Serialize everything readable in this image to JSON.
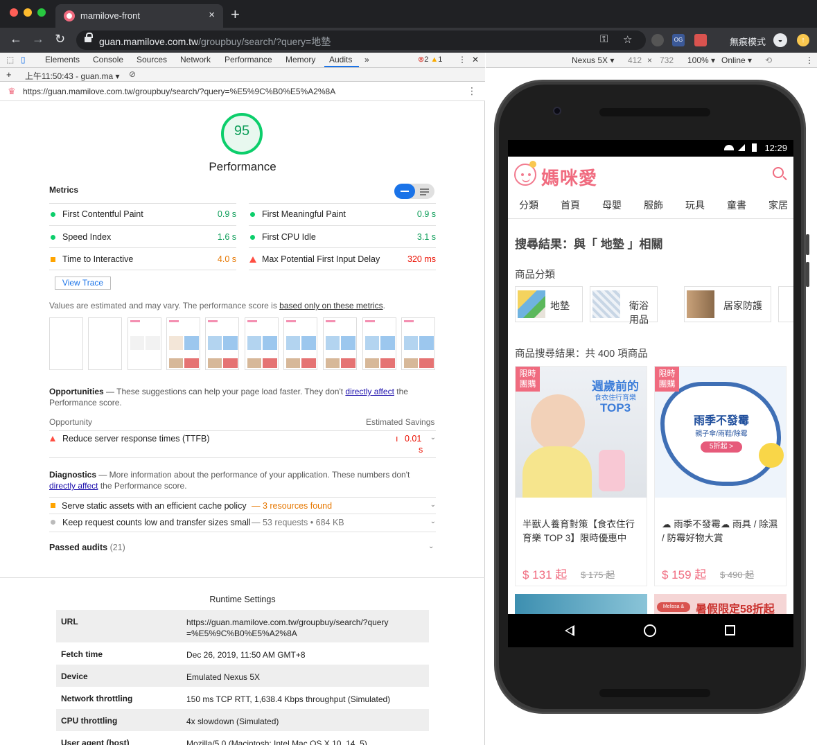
{
  "browser": {
    "tab_title": "mamilove-front",
    "tab_close": "×",
    "new_tab": "+",
    "url_host": "guan.mamilove.com.tw",
    "url_path": "/groupbuy/search/?query=地墊",
    "incognito_label": "無痕模式",
    "ext_og": "OG"
  },
  "devtools": {
    "tabs": [
      "Elements",
      "Console",
      "Sources",
      "Network",
      "Performance",
      "Memory",
      "Audits"
    ],
    "active_tab": "Audits",
    "more_tabs": "»",
    "errors": "2",
    "warnings": "1",
    "session_label": "上午11:50:43 - guan.ma",
    "audited_url": "https://guan.mamilove.com.tw/groupbuy/search/?query=%E5%9C%B0%E5%A2%8A"
  },
  "lighthouse": {
    "score": "95",
    "score_value": 95,
    "category": "Performance",
    "metrics_heading": "Metrics",
    "metrics": [
      {
        "name": "First Contentful Paint",
        "value": "0.9 s",
        "status": "pass"
      },
      {
        "name": "First Meaningful Paint",
        "value": "0.9 s",
        "status": "pass"
      },
      {
        "name": "Speed Index",
        "value": "1.6 s",
        "status": "pass"
      },
      {
        "name": "First CPU Idle",
        "value": "3.1 s",
        "status": "pass"
      },
      {
        "name": "Time to Interactive",
        "value": "4.0 s",
        "status": "average"
      },
      {
        "name": "Max Potential First Input Delay",
        "value": "320 ms",
        "status": "fail"
      }
    ],
    "view_trace": "View Trace",
    "estimated_note": "Values are estimated and may vary. The performance score is ",
    "estimated_link": "based only on these metrics",
    "estimated_end": ".",
    "opportunities_title": "Opportunities",
    "opportunities_desc": " — These suggestions can help your page load faster. They don't ",
    "opportunities_link": "directly affect",
    "opportunities_end": " the Performance score.",
    "col_opportunity": "Opportunity",
    "col_savings": "Estimated Savings",
    "opportunity_items": [
      {
        "name": "Reduce server response times (TTFB)",
        "saving": "0.01",
        "saving_unit": "s"
      }
    ],
    "diagnostics_title": "Diagnostics",
    "diagnostics_desc": " — More information about the performance of your application. These numbers don't ",
    "diagnostics_link": "directly affect",
    "diagnostics_end": " the Performance score.",
    "diagnostic_items": [
      {
        "name": "Serve static assets with an efficient cache policy",
        "detail": " — 3 resources found"
      },
      {
        "name": "Keep request counts low and transfer sizes small",
        "detail": " — 53 requests • 684 KB"
      }
    ],
    "passed_label": "Passed audits",
    "passed_count": "(21)",
    "runtime_title": "Runtime Settings",
    "runtime": [
      {
        "key": "URL",
        "value": "https://guan.mamilove.com.tw/groupbuy/search/?query=%E5%9C%B0%E5%A2%8A"
      },
      {
        "key": "Fetch time",
        "value": "Dec 26, 2019, 11:50 AM GMT+8"
      },
      {
        "key": "Device",
        "value": "Emulated Nexus 5X"
      },
      {
        "key": "Network throttling",
        "value": "150 ms TCP RTT, 1,638.4 Kbps throughput (Simulated)"
      },
      {
        "key": "CPU throttling",
        "value": "4x slowdown (Simulated)"
      },
      {
        "key": "User agent (host)",
        "value": "Mozilla/5.0 (Macintosh; Intel Mac OS X 10_14_5)"
      }
    ]
  },
  "device_toolbar": {
    "device": "Nexus 5X ▾",
    "width": "412",
    "times": "×",
    "height": "732",
    "zoom": "100% ▾",
    "network": "Online ▾"
  },
  "phone": {
    "time": "12:29",
    "logo": "媽咪愛",
    "categories": [
      "分類",
      "首頁",
      "母嬰",
      "服飾",
      "玩具",
      "童書",
      "家居"
    ],
    "search_title": "搜尋結果：與「 地墊 」相關",
    "category_heading": "商品分類",
    "category_cards": [
      {
        "label": "地墊"
      },
      {
        "label": "衛浴用品"
      },
      {
        "label": "居家防護"
      }
    ],
    "results_heading": "商品搜尋結果：共 400 項商品",
    "products": [
      {
        "badge": "限時團購",
        "name": "半獸人養育對策【食衣住行育樂 TOP 3】限時優惠中",
        "price": "$ 131 起",
        "original": "$ 175 起",
        "banner": "週歲前的",
        "banner2": "食衣住行育樂",
        "banner3": "TOP3"
      },
      {
        "badge": "限時團購",
        "name": "☁ 雨季不發霉☁ 雨具 / 除濕 / 防霉好物大賞",
        "price": "$ 159 起",
        "original": "$ 490 起",
        "banner": "雨季不發霉",
        "banner2": "親子傘/雨鞋/除霉",
        "banner3": "5折起 >"
      }
    ],
    "next_banner": "暑假限定58折起",
    "next_brand": "Melissa & Doug"
  }
}
